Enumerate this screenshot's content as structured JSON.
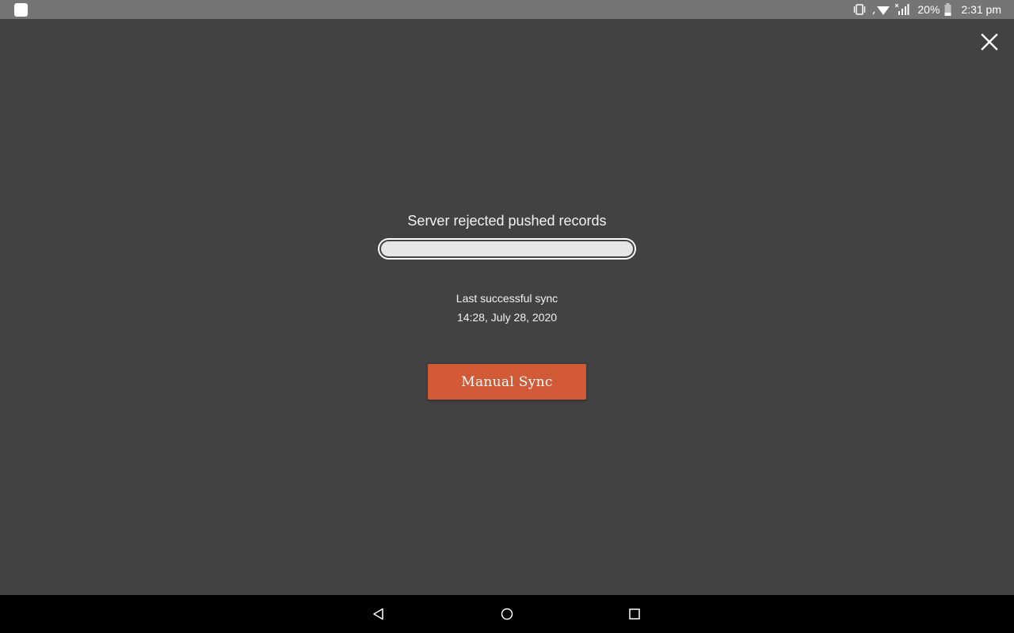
{
  "status_bar": {
    "battery_percent": "20%",
    "time": "2:31 pm",
    "icons": [
      "vibrate-icon",
      "wifi-icon",
      "signal-icon",
      "battery-icon"
    ]
  },
  "dialog": {
    "close_icon": "close-icon",
    "status_message": "Server rejected pushed records",
    "progress": 1.0,
    "last_sync_label": "Last successful sync",
    "last_sync_time": "14:28, July 28, 2020",
    "manual_sync_label": "Manual Sync"
  },
  "nav_bar": {
    "buttons": [
      "back-icon",
      "home-icon",
      "recents-icon"
    ]
  },
  "colors": {
    "background": "#424242",
    "accent": "#d35a37",
    "status_bar": "#757575",
    "nav_bar": "#000000"
  }
}
